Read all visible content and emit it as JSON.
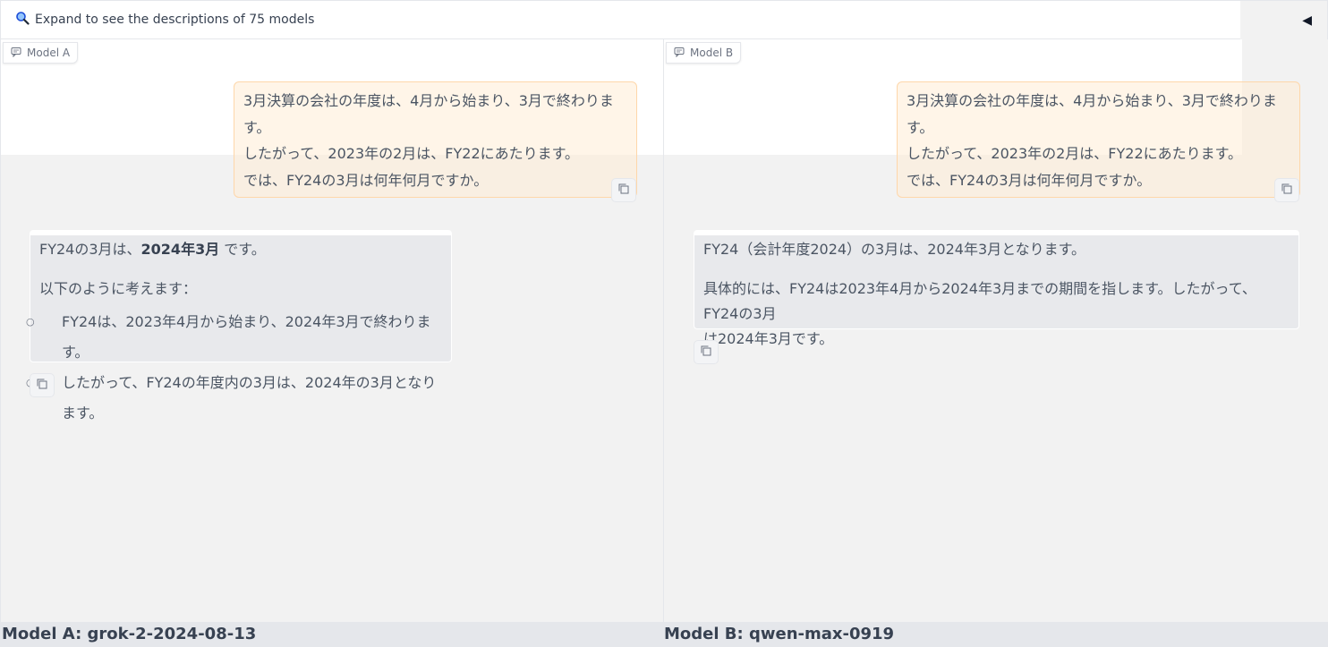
{
  "topbar": {
    "expand_label": "Expand to see the descriptions of 75 models",
    "collapse_glyph": "◀"
  },
  "panels": {
    "a": {
      "tag": "Model A",
      "user_lines": [
        "3月決算の会社の年度は、4月から始まり、3月で終わります。",
        "したがって、2023年の2月は、FY22にあたります。",
        "では、FY24の3月は何年何月ですか。"
      ],
      "bot": {
        "p1_pre": "FY24の3月は、",
        "p1_bold": "2024年3月",
        "p1_post": " です。",
        "p2": "以下のように考えます：",
        "bullets": [
          "FY24は、2023年4月から始まり、2024年3月で終わります。",
          "したがって、FY24の年度内の3月は、2024年の3月となります。"
        ]
      }
    },
    "b": {
      "tag": "Model B",
      "user_lines": [
        "3月決算の会社の年度は、4月から始まり、3月で終わります。",
        "したがって、2023年の2月は、FY22にあたります。",
        "では、FY24の3月は何年何月ですか。"
      ],
      "bot": {
        "p1": "FY24（会計年度2024）の3月は、2024年3月となります。",
        "p2_line1": "具体的には、FY24は2023年4月から2024年3月までの期間を指します。したがって、FY24の3月",
        "p2_line2": "は2024年3月です。"
      }
    }
  },
  "footer": {
    "model_a": "Model A: grok-2-2024-08-13",
    "model_b": "Model B: qwen-max-0919"
  },
  "colors": {
    "user_bubble_border": "#fed7aa",
    "user_bubble_bg": "#fff4e6",
    "bot_bubble_bg": "#e8e9ec",
    "panel_bg": "#f2f2f2"
  },
  "icons": {
    "expand": "magnifier-icon",
    "tag": "chat-icon",
    "copy": "copy-icon"
  }
}
